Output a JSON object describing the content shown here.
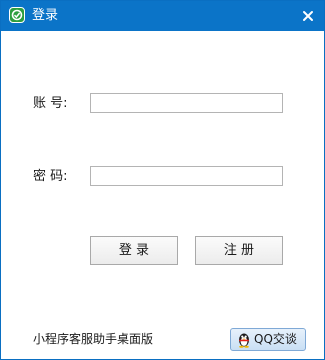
{
  "window": {
    "title": "登录"
  },
  "form": {
    "account_label": "账 号:",
    "account_value": "",
    "password_label": "密 码:",
    "password_value": ""
  },
  "buttons": {
    "login_label": "登 录",
    "register_label": "注 册"
  },
  "footer": {
    "app_name": "小程序客服助手桌面版",
    "qq_label": "QQ交谈"
  },
  "colors": {
    "titlebar": "#0b74c8",
    "app_icon": "#2e9e3f"
  },
  "icons": {
    "app": "app-logo-icon",
    "close": "close-icon",
    "qq": "qq-penguin-icon"
  }
}
